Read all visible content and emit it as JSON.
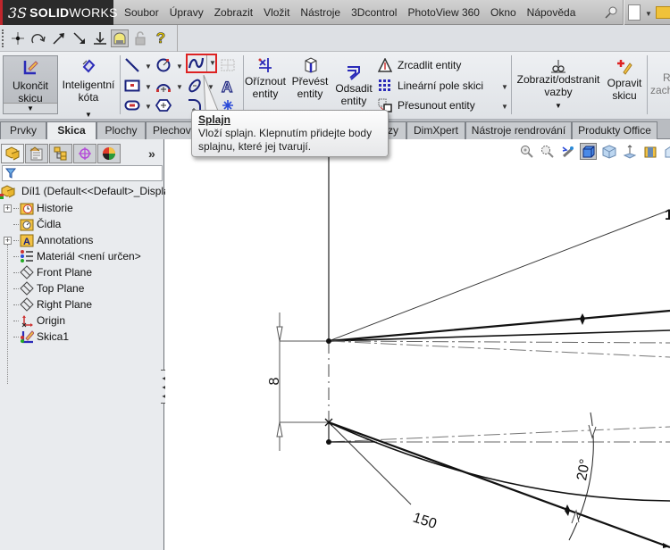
{
  "app": {
    "logo_prefix": "3S",
    "logo_text_bold": "SOLID",
    "logo_text_rest": "WORKS",
    "accent_color": "#c0262c"
  },
  "menu": {
    "items": [
      "Soubor",
      "Úpravy",
      "Zobrazit",
      "Vložit",
      "Nástroje",
      "3Dcontrol",
      "PhotoView 360",
      "Okno",
      "Nápověda"
    ],
    "icons": [
      "pin-icon",
      "new-document-icon",
      "open-folder-icon"
    ]
  },
  "quickbar": {
    "icons": [
      "point-icon",
      "rotate-icon",
      "arrow-up-right-icon",
      "arrow-down-right-icon",
      "ground-icon",
      "fit-icon",
      "lock-icon",
      "help-icon"
    ]
  },
  "commandmanager": {
    "exit_sketch": {
      "line1": "Ukončit",
      "line2": "skicu"
    },
    "smart_dim": {
      "line1": "Inteligentní",
      "line2": "kóta"
    },
    "trim": {
      "line1": "Oříznout",
      "line2": "entity"
    },
    "convert": {
      "line1": "Převést",
      "line2": "entity"
    },
    "offset": {
      "line1": "Odsadit",
      "line2": "entity"
    },
    "mirror": "Zrcadlit entity",
    "linear_pattern": "Lineární pole skici",
    "move": "Přesunout entity",
    "relations": {
      "line1": "Zobrazit/odstranit",
      "line2": "vazby"
    },
    "repair": {
      "line1": "Opravit",
      "line2": "skicu"
    },
    "cut_off": {
      "line1": "R",
      "line2": "zach"
    }
  },
  "tabs": {
    "items": [
      "Prvky",
      "Skica",
      "Plochy",
      "Plechov",
      "zy",
      "DimXpert",
      "Nástroje rendrování",
      "Produkty Office"
    ],
    "active": "Skica"
  },
  "tooltip": {
    "title": "Splajn",
    "line1": "Vloží splajn. Klepnutím přidejte body",
    "line2": "splajnu, které jej tvarují."
  },
  "feature_tree": {
    "root": "Díl1  (Default<<Default>_Displa",
    "items": [
      {
        "label": "Historie",
        "icon": "history-icon",
        "expandable": true
      },
      {
        "label": "Čidla",
        "icon": "sensors-icon",
        "expandable": false
      },
      {
        "label": "Annotations",
        "icon": "annotations-icon",
        "expandable": true
      },
      {
        "label": "Materiál <není určen>",
        "icon": "material-icon",
        "expandable": false
      },
      {
        "label": "Front Plane",
        "icon": "plane-icon",
        "expandable": false
      },
      {
        "label": "Top Plane",
        "icon": "plane-icon",
        "expandable": false
      },
      {
        "label": "Right Plane",
        "icon": "plane-icon",
        "expandable": false
      },
      {
        "label": "Origin",
        "icon": "origin-icon",
        "expandable": false
      },
      {
        "label": "Skica1",
        "icon": "sketch-icon",
        "expandable": false
      }
    ],
    "more_label": "»"
  },
  "drawing": {
    "dim_vertical": "8",
    "dim_length": "150",
    "dim_angle": "20°",
    "dim_cut": "1"
  }
}
